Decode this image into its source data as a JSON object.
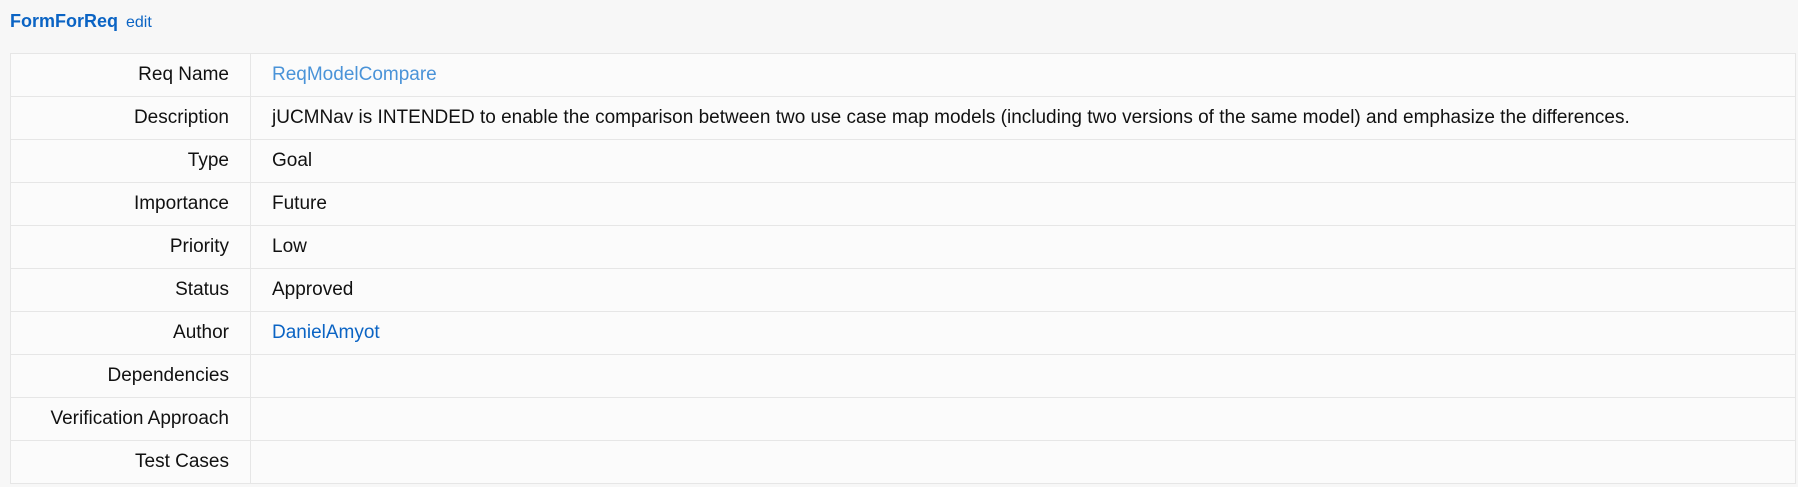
{
  "header": {
    "title": "FormForReq",
    "edit_label": "edit"
  },
  "rows": {
    "req_name": {
      "label": "Req Name",
      "value": "ReqModelCompare"
    },
    "description": {
      "label": "Description",
      "value": "jUCMNav is INTENDED to enable the comparison between two use case map models (including two versions of the same model) and emphasize the differences."
    },
    "type": {
      "label": "Type",
      "value": "Goal"
    },
    "importance": {
      "label": "Importance",
      "value": "Future"
    },
    "priority": {
      "label": "Priority",
      "value": "Low"
    },
    "status": {
      "label": "Status",
      "value": "Approved"
    },
    "author": {
      "label": "Author",
      "value": "DanielAmyot"
    },
    "dependencies": {
      "label": "Dependencies",
      "value": ""
    },
    "verification_approach": {
      "label": "Verification Approach",
      "value": ""
    },
    "test_cases": {
      "label": "Test Cases",
      "value": ""
    }
  },
  "colors": {
    "link": "#0b64c4",
    "link_pale": "#4a93d8",
    "border": "#e6e6e6",
    "background": "#f7f7f7"
  }
}
